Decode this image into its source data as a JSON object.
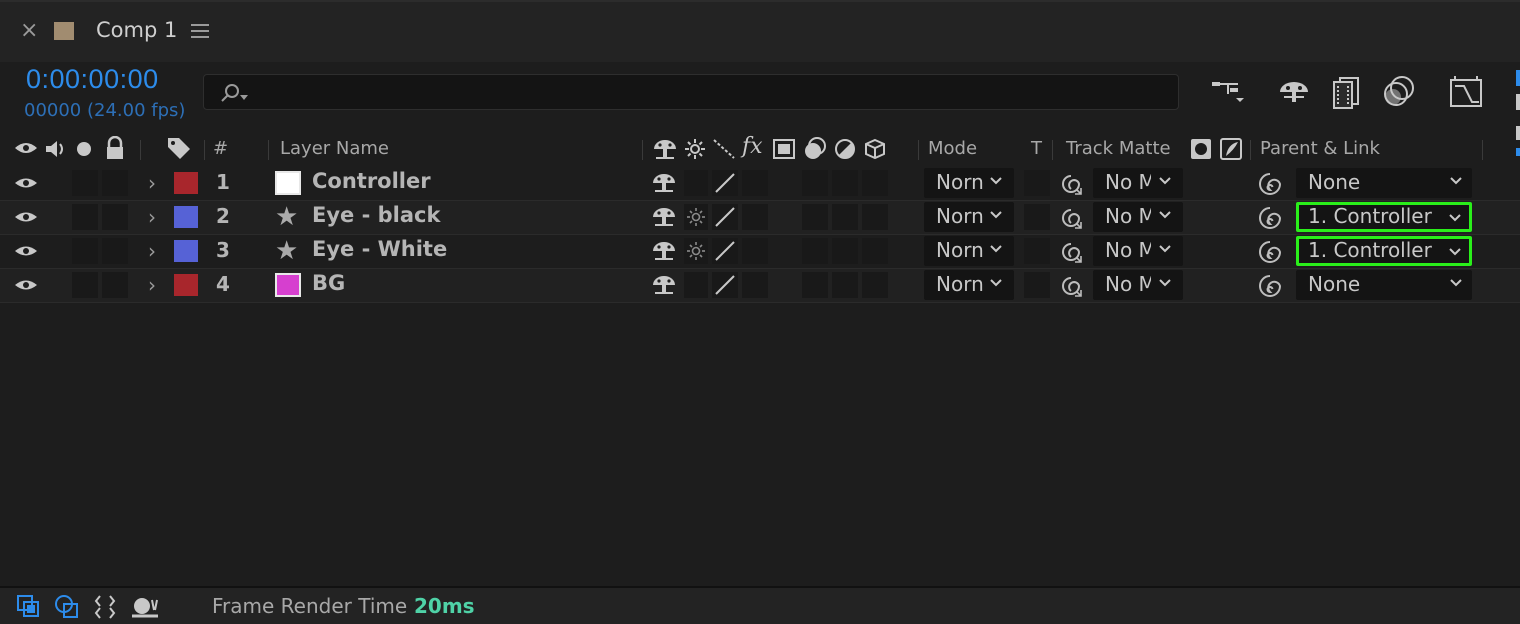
{
  "tab": {
    "close_glyph": "×",
    "title": "Comp 1",
    "swatch_color": "#a18c70"
  },
  "time": {
    "timecode": "0:00:00:00",
    "frames": "00000 (24.00 fps)"
  },
  "search": {
    "placeholder": ""
  },
  "toolbar_icons": [
    "composition-flowchart-icon",
    "draft-3d-icon",
    "frame-blending-icon",
    "motion-blur-icon",
    "graph-editor-icon"
  ],
  "header": {
    "layer_name": "Layer Name",
    "number": "#",
    "mode": "Mode",
    "t": "T",
    "track_matte": "Track Matte",
    "parent_link": "Parent & Link"
  },
  "layers": [
    {
      "number": "1",
      "name": "Controller",
      "label_color": "#a8262c",
      "source": "solid-white",
      "mode": "Norn",
      "track_matte": "No M",
      "parent": "None",
      "highlighted": false
    },
    {
      "number": "2",
      "name": "Eye - black",
      "label_color": "#5662d6",
      "source": "shape",
      "mode": "Norn",
      "track_matte": "No M",
      "parent": "1. Controller",
      "highlighted": true
    },
    {
      "number": "3",
      "name": "Eye - White",
      "label_color": "#5662d6",
      "source": "shape",
      "mode": "Norn",
      "track_matte": "No M",
      "parent": "1. Controller",
      "highlighted": true
    },
    {
      "number": "4",
      "name": "BG",
      "label_color": "#a8262c",
      "source": "solid-magenta",
      "mode": "Norn",
      "track_matte": "No M",
      "parent": "None",
      "highlighted": false
    }
  ],
  "status": {
    "frame_render_label": "Frame Render Time",
    "frame_render_value": "20ms"
  },
  "colors": {
    "accent": "#2d8ceb",
    "highlight": "#2aef1a",
    "render_time": "#4fd2a7"
  }
}
